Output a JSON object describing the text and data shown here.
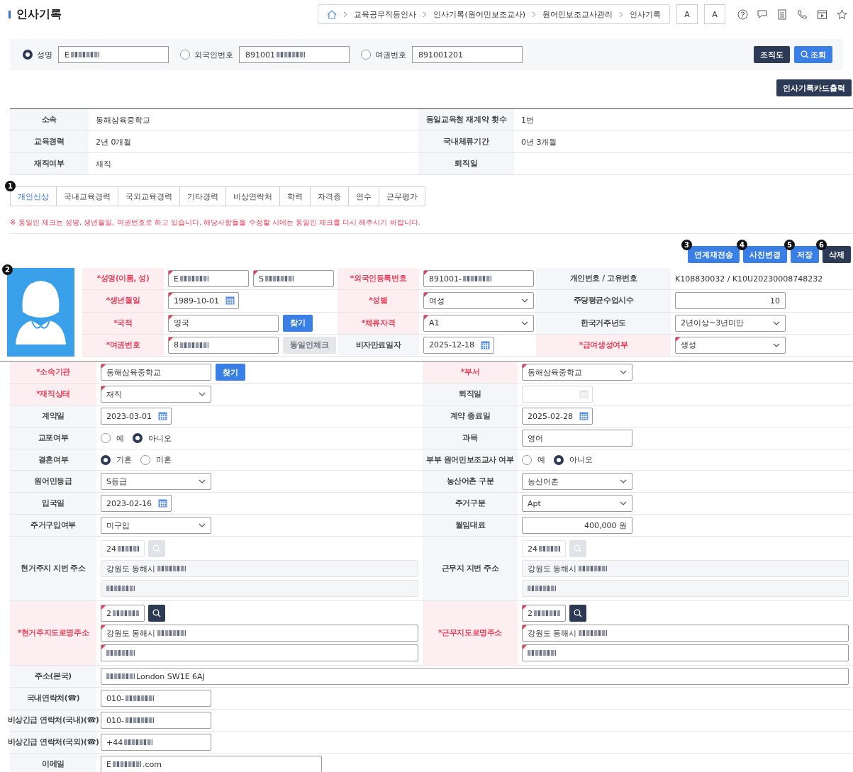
{
  "header": {
    "title": "인사기록",
    "breadcrumb": [
      "교육공무직등인사",
      "인사기록(원어민보조교사)",
      "원어민보조교사관리",
      "인사기록"
    ],
    "font_buttons": [
      "A",
      "A"
    ]
  },
  "search": {
    "options": [
      {
        "label": "성명",
        "selected": true,
        "value": "E",
        "blurred": true
      },
      {
        "label": "외국인번호",
        "selected": false,
        "value": "891001",
        "blurred": true
      },
      {
        "label": "여권번호",
        "selected": false,
        "value": "891001201"
      }
    ],
    "buttons": [
      {
        "label": "조직도",
        "kind": "dark"
      },
      {
        "label": "조회",
        "kind": "primary"
      }
    ]
  },
  "print_button": "인사기록카드출력",
  "summary": [
    {
      "label": "소속",
      "value": "동해삼육중학교",
      "label_2": "동일교육청 재계약 횟수",
      "value_2": "1번"
    },
    {
      "label": "교육경력",
      "value": "2년 0개월",
      "label_2": "국내체류기간",
      "value_2": "0년 3개월"
    },
    {
      "label": "재직여부",
      "value": "재직",
      "label_2": "퇴직일"
    }
  ],
  "tabs": {
    "marker": "1",
    "items": [
      {
        "label": "개인신상",
        "selected": true
      },
      {
        "label": "국내교육경력",
        "selected": false
      },
      {
        "label": "국외교육경력",
        "selected": false
      },
      {
        "label": "기타경력",
        "selected": false
      },
      {
        "label": "비상연락처",
        "selected": false
      },
      {
        "label": "학력",
        "selected": false
      },
      {
        "label": "자격증",
        "selected": false
      },
      {
        "label": "연수",
        "selected": false
      },
      {
        "label": "근무평가",
        "selected": false
      }
    ]
  },
  "notice": "※ 동일인 체크는 성명, 생년월일, 여권번호로 하고 있습니다. 해당사항들을 수정할 시에는 동일인 체크를 다시 해주시기 바랍니다.",
  "actions": [
    {
      "label": "연계재전송",
      "marker": "3",
      "kind": "primary"
    },
    {
      "label": "사진변경",
      "marker": "4",
      "kind": "primary"
    },
    {
      "label": "저장",
      "marker": "5",
      "kind": "primary"
    },
    {
      "label": "삭제",
      "marker": "6",
      "kind": "dark"
    }
  ],
  "profile": {
    "photo_marker": "2",
    "rows": [
      [
        {
          "label": "*성명(이름, 성)",
          "required": true,
          "controls": [
            {
              "kind": "text",
              "value": "E",
              "blurred": true
            },
            {
              "kind": "text",
              "value": "S",
              "blurred": true
            }
          ]
        },
        {
          "label": "*외국인등록번호",
          "required": true,
          "controls": [
            {
              "kind": "text",
              "value": "891001-",
              "blurred": true
            }
          ]
        },
        {
          "label": "개인번호 / 고유번호",
          "required": false,
          "controls": [
            {
              "kind": "plain",
              "value": "K108830032 / K10U20230008748232"
            }
          ]
        }
      ],
      [
        {
          "label": "*생년월일",
          "required": true,
          "controls": [
            {
              "kind": "date",
              "value": "1989-10-01",
              "disabled": false
            }
          ]
        },
        {
          "label": "*성별",
          "required": true,
          "controls": [
            {
              "kind": "select",
              "value": "여성"
            }
          ]
        },
        {
          "label": "주당평균수업시수",
          "required": false,
          "controls": [
            {
              "kind": "number",
              "value": "10"
            }
          ]
        }
      ],
      [
        {
          "label": "*국적",
          "required": true,
          "controls": [
            {
              "kind": "text",
              "value": "영국"
            },
            {
              "kind": "button",
              "label": "찾기",
              "disabled": false
            }
          ]
        },
        {
          "label": "*체류자격",
          "required": true,
          "controls": [
            {
              "kind": "select",
              "value": "A1"
            }
          ]
        },
        {
          "label": "한국거주년도",
          "required": false,
          "controls": [
            {
              "kind": "select",
              "value": "2년이상~3년미만"
            }
          ]
        }
      ],
      [
        {
          "label": "*여권번호",
          "required": true,
          "controls": [
            {
              "kind": "text",
              "value": "8",
              "blurred": true
            },
            {
              "kind": "button",
              "label": "동일인체크",
              "disabled": true
            }
          ]
        },
        {
          "label": "비자만료일자",
          "required": false,
          "controls": [
            {
              "kind": "date",
              "value": "2025-12-18",
              "disabled": false
            }
          ]
        },
        {
          "label": "*급여생성여부",
          "required": true,
          "controls": [
            {
              "kind": "select",
              "value": "생성"
            }
          ]
        }
      ]
    ]
  },
  "details": {
    "rows": [
      [
        {
          "label": "*소속기관",
          "required": true,
          "controls": [
            {
              "kind": "text",
              "value": "동해삼육중학교"
            },
            {
              "kind": "button",
              "label": "찾기",
              "disabled": false
            }
          ]
        },
        {
          "label": "*부서",
          "required": true,
          "controls": [
            {
              "kind": "select",
              "value": "동해삼육중학교"
            }
          ]
        }
      ],
      [
        {
          "label": "*재직상태",
          "required": true,
          "controls": [
            {
              "kind": "select",
              "value": "재직"
            }
          ]
        },
        {
          "label": "퇴직일",
          "required": false,
          "controls": [
            {
              "kind": "date",
              "disabled": true
            }
          ]
        }
      ],
      [
        {
          "label": "계약일",
          "required": false,
          "controls": [
            {
              "kind": "date",
              "value": "2023-03-01",
              "disabled": false
            }
          ]
        },
        {
          "label": "계약 종료일",
          "required": false,
          "controls": [
            {
              "kind": "date",
              "value": "2025-02-28",
              "disabled": false
            }
          ]
        }
      ],
      [
        {
          "label": "교포여부",
          "required": false,
          "controls": [
            {
              "kind": "radio",
              "options": [
                {
                  "label": "예",
                  "selected": false
                },
                {
                  "label": "아니오",
                  "selected": true
                }
              ]
            }
          ]
        },
        {
          "label": "과목",
          "required": false,
          "controls": [
            {
              "kind": "text",
              "value": "영어"
            }
          ]
        }
      ],
      [
        {
          "label": "결혼여부",
          "required": false,
          "controls": [
            {
              "kind": "radio",
              "options": [
                {
                  "label": "기혼",
                  "selected": true
                },
                {
                  "label": "미혼",
                  "selected": false
                }
              ]
            }
          ]
        },
        {
          "label": "부부 원어민보조교사 여부",
          "required": false,
          "controls": [
            {
              "kind": "radio",
              "options": [
                {
                  "label": "예",
                  "selected": false
                },
                {
                  "label": "아니오",
                  "selected": true
                }
              ]
            }
          ]
        }
      ],
      [
        {
          "label": "원어민등급",
          "required": false,
          "controls": [
            {
              "kind": "select",
              "value": "S등급"
            }
          ]
        },
        {
          "label": "농산어촌 구분",
          "required": false,
          "controls": [
            {
              "kind": "select",
              "value": "농산어촌"
            }
          ]
        }
      ],
      [
        {
          "label": "입국일",
          "required": false,
          "controls": [
            {
              "kind": "date",
              "value": "2023-02-16",
              "disabled": false
            }
          ]
        },
        {
          "label": "주거구분",
          "required": false,
          "controls": [
            {
              "kind": "select",
              "value": "Apt"
            }
          ]
        }
      ],
      [
        {
          "label": "주거구입여부",
          "required": false,
          "controls": [
            {
              "kind": "select",
              "value": "미구입"
            }
          ]
        },
        {
          "label": "월임대료",
          "required": false,
          "controls": [
            {
              "kind": "number",
              "value": "400,000 원"
            }
          ]
        }
      ],
      [
        {
          "label": "현거주지 지번 주소",
          "required": false,
          "controls": [
            {
              "kind": "address",
              "editable": false,
              "zip": {
                "value": "24",
                "blurred": true
              },
              "line_1": {
                "value": "강원도 동해시",
                "blurred": true
              },
              "line_2": {
                "blurred": true
              }
            }
          ]
        },
        {
          "label": "근무지 지번 주소",
          "required": false,
          "controls": [
            {
              "kind": "address",
              "editable": false,
              "zip": {
                "value": "24",
                "blurred": true
              },
              "line_1": {
                "value": "강원도 동해시",
                "blurred": true
              },
              "line_2": {
                "blurred": true
              }
            }
          ]
        }
      ],
      [
        {
          "label": "*현거주지도로명주소",
          "required": true,
          "controls": [
            {
              "kind": "address",
              "editable": true,
              "zip": {
                "value": "2",
                "blurred": true
              },
              "line_1": {
                "value": "강원도 동해시",
                "blurred": true
              },
              "line_2": {
                "blurred": true
              }
            }
          ]
        },
        {
          "label": "*근무지도로명주소",
          "required": true,
          "controls": [
            {
              "kind": "address",
              "editable": true,
              "zip": {
                "value": "2",
                "blurred": true
              },
              "line_1": {
                "value": "강원도 동해시",
                "blurred": true
              },
              "line_2": {
                "blurred": true
              }
            }
          ]
        }
      ],
      [
        {
          "label": "주소(본국)",
          "required": false,
          "controls": [
            {
              "kind": "wide",
              "blurred": true,
              "suffix": "London SW1E 6AJ"
            }
          ]
        }
      ],
      [
        {
          "label": "국내연락처(☎)",
          "required": false,
          "controls": [
            {
              "kind": "text",
              "value": "010-",
              "blurred": true
            }
          ]
        }
      ],
      [
        {
          "label": "비상긴급 연락처(국내)(☎)",
          "required": false,
          "controls": [
            {
              "kind": "text",
              "value": "010-",
              "blurred": true
            }
          ]
        }
      ],
      [
        {
          "label": "비상긴급 연락처(국외)(☎)",
          "required": false,
          "controls": [
            {
              "kind": "text",
              "value": "+44",
              "blurred": true
            }
          ]
        }
      ],
      [
        {
          "label": "이메일",
          "required": false,
          "controls": [
            {
              "kind": "email",
              "value": "E",
              "blurred": true,
              "suffix": ".com"
            }
          ]
        }
      ]
    ]
  }
}
